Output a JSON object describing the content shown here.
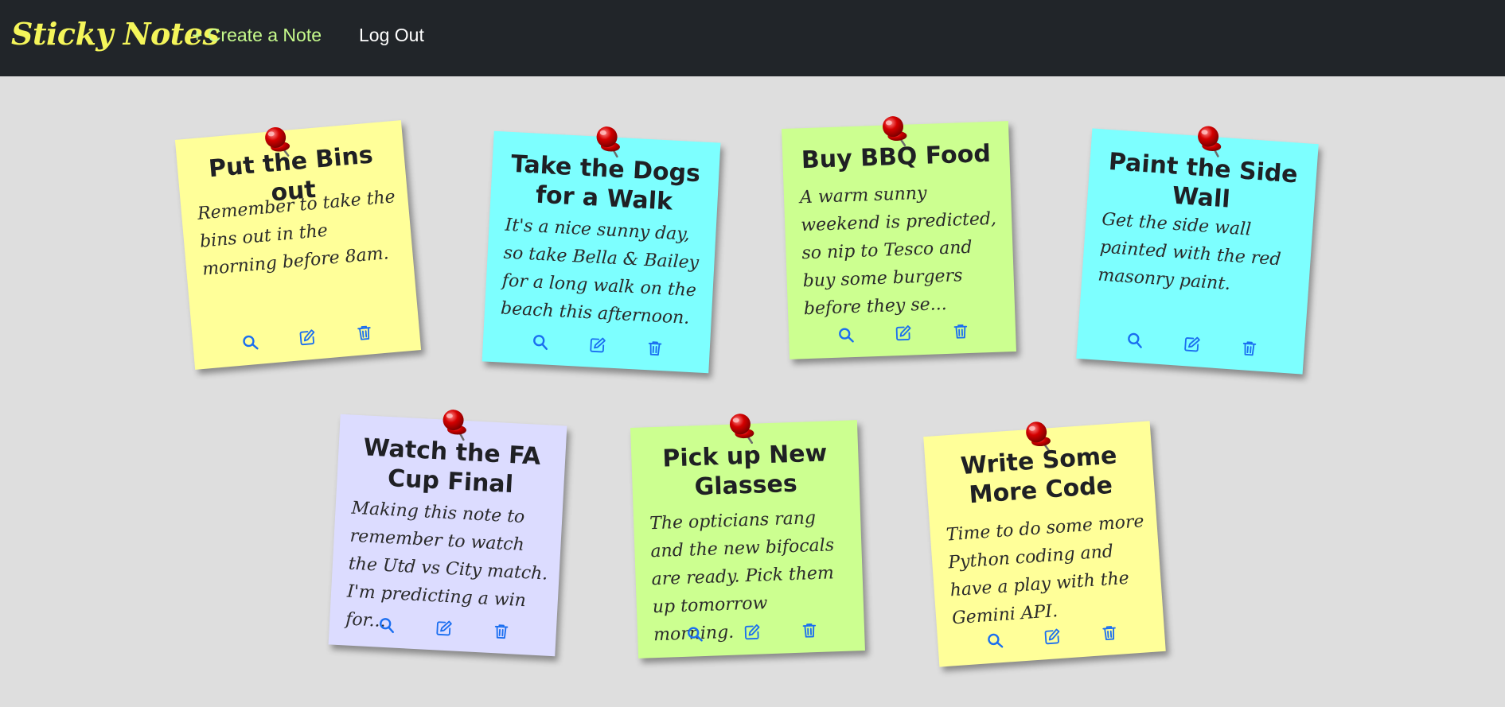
{
  "navbar": {
    "brand": "Sticky Notes",
    "create_label": "+ Create a Note",
    "logout_label": "Log Out"
  },
  "colors": {
    "navbar_bg": "#212529",
    "brand": "#f4f55a",
    "create_link": "#c6fa8c",
    "page_bg": "#dedede",
    "action_icon": "#1a6ef0",
    "pin": "#cc0000"
  },
  "icons": {
    "view": "search-icon",
    "edit": "edit-icon",
    "delete": "trash-icon",
    "pin": "pushpin-icon"
  },
  "notes": [
    {
      "title": "Put the Bins out",
      "body": "Remember to take the bins out in the morning before 8am.",
      "color": "#ffff99"
    },
    {
      "title": "Take the Dogs for a Walk",
      "body": "It's a nice sunny day, so take Bella & Bailey for a long walk on the beach this afternoon.",
      "color": "#7dffff"
    },
    {
      "title": "Buy BBQ Food",
      "body": "A warm sunny weekend is predicted, so nip to Tesco and buy some burgers before they se...",
      "color": "#ccff90"
    },
    {
      "title": "Paint the Side Wall",
      "body": "Get the side wall painted with the red masonry paint.",
      "color": "#7dffff"
    },
    {
      "title": "Watch the FA Cup Final",
      "body": "Making this note to remember to watch the Utd vs City match. I'm predicting a win for...",
      "color": "#dcdcff"
    },
    {
      "title": "Pick up New Glasses",
      "body": "The opticians rang and the new bifocals are ready. Pick them up tomorrow morning.",
      "color": "#ccff90"
    },
    {
      "title": "Write Some More Code",
      "body": "Time to do some more Python coding and have a play with the Gemini API.",
      "color": "#ffff99"
    }
  ]
}
